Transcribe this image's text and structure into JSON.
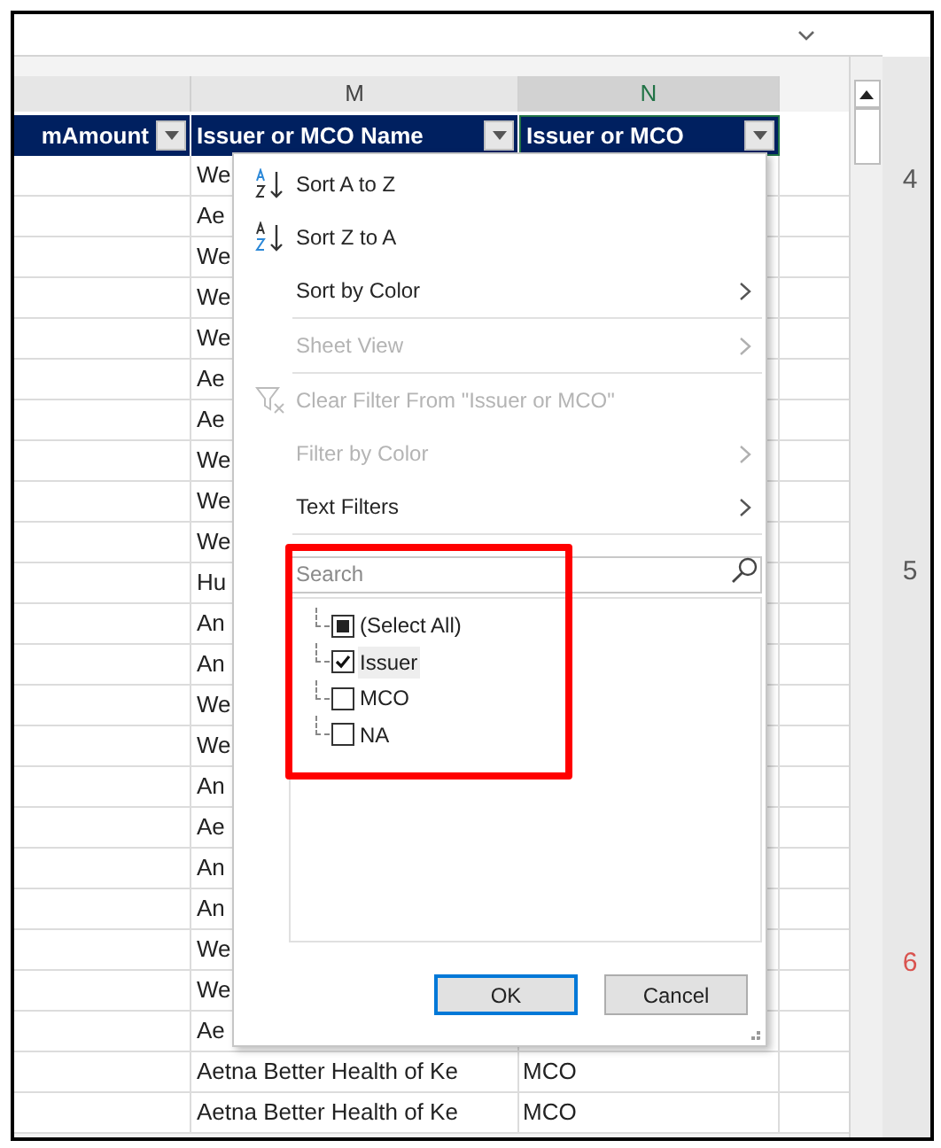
{
  "column_letters": [
    {
      "selected": false
    },
    {
      "letter": "M",
      "selected": false
    },
    {
      "letter": "N",
      "selected": true
    }
  ],
  "header_row": [
    {
      "label": "mAmount"
    },
    {
      "label": "Issuer or MCO Name"
    },
    {
      "label": "Issuer or MCO"
    }
  ],
  "rows": [
    {
      "col_m": "We"
    },
    {
      "col_m": "Ae"
    },
    {
      "col_m": "We"
    },
    {
      "col_m": "We"
    },
    {
      "col_m": "We"
    },
    {
      "col_m": "Ae"
    },
    {
      "col_m": "Ae"
    },
    {
      "col_m": "We"
    },
    {
      "col_m": "We"
    },
    {
      "col_m": "We"
    },
    {
      "col_m": "Hu"
    },
    {
      "col_m": "An"
    },
    {
      "col_m": "An"
    },
    {
      "col_m": "We"
    },
    {
      "col_m": "We"
    },
    {
      "col_m": "An"
    },
    {
      "col_m": "Ae"
    },
    {
      "col_m": "An"
    },
    {
      "col_m": "An"
    },
    {
      "col_m": "We"
    },
    {
      "col_m": "We"
    },
    {
      "col_m": "Ae"
    },
    {
      "col_m": "Aetna Better Health of Ke",
      "col_n": "MCO"
    },
    {
      "col_m": "Aetna Better Health of Ke",
      "col_n": "MCO"
    }
  ],
  "row_numbers": [
    {
      "text": "4",
      "color": "#595959"
    },
    {
      "text": "5",
      "color": "#595959"
    },
    {
      "text": "6",
      "color": "#d9534f"
    }
  ],
  "filter_menu": {
    "items": [
      {
        "kind": "sort-az",
        "label": "Sort A to Z",
        "disabled": false,
        "submenu": false
      },
      {
        "kind": "sort-za",
        "label": "Sort Z to A",
        "disabled": false,
        "submenu": false
      },
      {
        "kind": "plain",
        "label": "Sort by Color",
        "disabled": false,
        "submenu": true
      },
      {
        "kind": "divider"
      },
      {
        "kind": "plain",
        "label": "Sheet View",
        "disabled": true,
        "submenu": true
      },
      {
        "kind": "divider"
      },
      {
        "kind": "clear-filter",
        "label": "Clear Filter From \"Issuer or MCO\"",
        "disabled": true,
        "submenu": false
      },
      {
        "kind": "plain",
        "label": "Filter by Color",
        "disabled": true,
        "submenu": true
      },
      {
        "kind": "plain",
        "label": "Text Filters",
        "disabled": false,
        "submenu": true
      },
      {
        "kind": "divider"
      }
    ],
    "search": {
      "placeholder": "Search"
    },
    "values": [
      {
        "label": "(Select All)",
        "checked": false,
        "indeterminate": true,
        "selected": false
      },
      {
        "label": "Issuer",
        "checked": true,
        "indeterminate": false,
        "selected": true
      },
      {
        "label": "MCO",
        "checked": false,
        "indeterminate": false,
        "selected": false
      },
      {
        "label": "NA",
        "checked": false,
        "indeterminate": false,
        "selected": false
      }
    ],
    "buttons": [
      {
        "label": "OK",
        "default": true
      },
      {
        "label": "Cancel",
        "default": false
      }
    ]
  }
}
